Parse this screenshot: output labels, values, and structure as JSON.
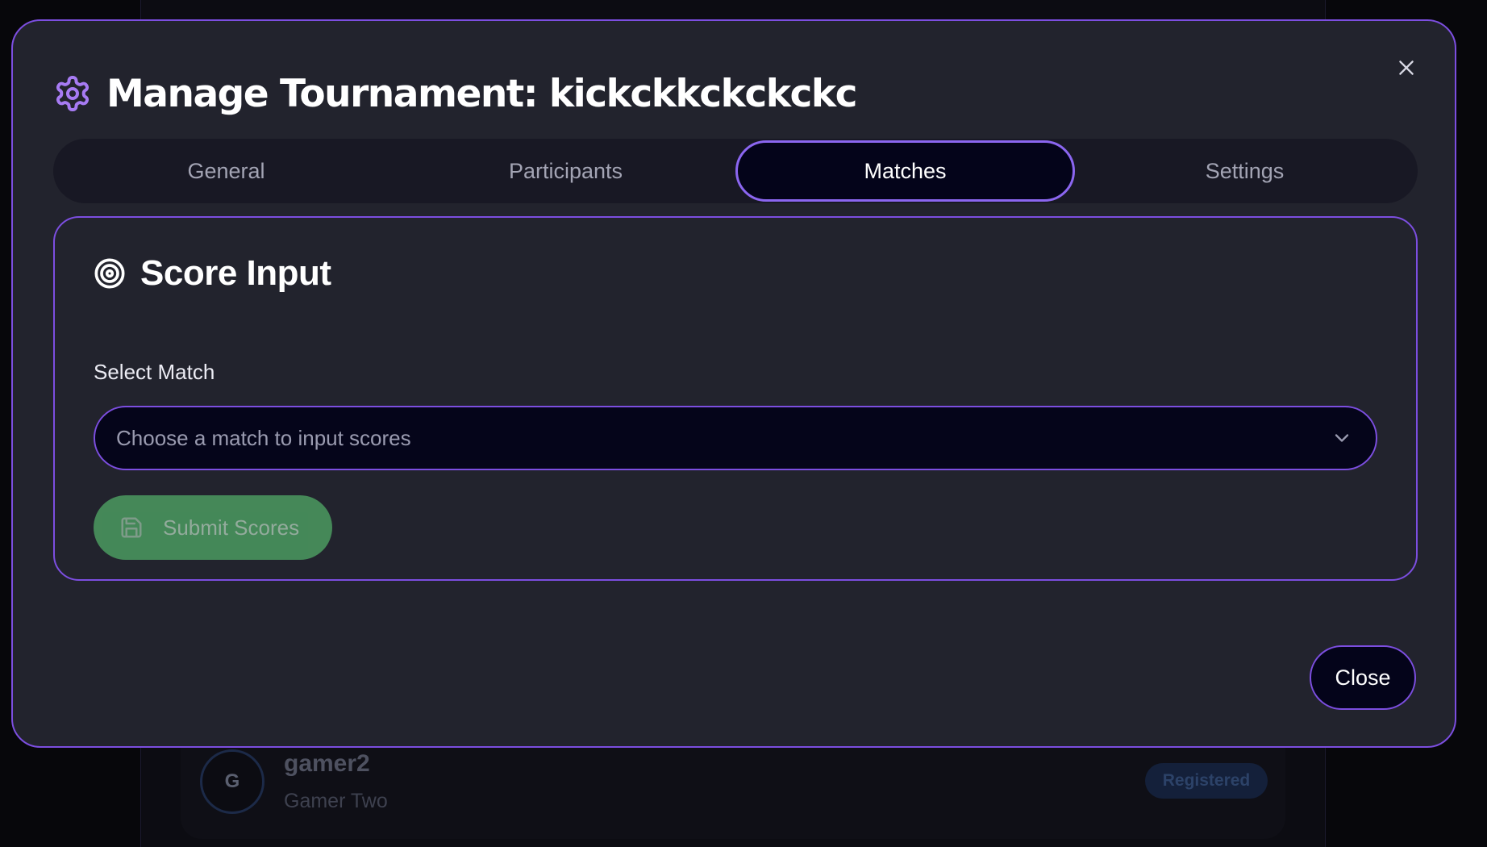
{
  "background": {
    "participant": {
      "avatar_initial": "G",
      "username": "gamer2",
      "display_name": "Gamer Two",
      "status_badge": "Registered"
    }
  },
  "modal": {
    "title": "Manage Tournament: kickckkckckckc",
    "icon": "gear-icon",
    "close_icon": "close-icon",
    "tabs": [
      {
        "label": "General",
        "active": false
      },
      {
        "label": "Participants",
        "active": false
      },
      {
        "label": "Matches",
        "active": true
      },
      {
        "label": "Settings",
        "active": false
      }
    ],
    "score_input": {
      "title": "Score Input",
      "icon": "target-icon",
      "select_label": "Select Match",
      "select_placeholder": "Choose a match to input scores",
      "submit_label": "Submit Scores",
      "submit_icon": "save-icon",
      "submit_disabled": true
    },
    "close_label": "Close"
  },
  "colors": {
    "accent": "#7c4ee0",
    "accent_light": "#a77bf3",
    "modal_bg": "#22232d",
    "submit_bg": "#4b9a60"
  }
}
